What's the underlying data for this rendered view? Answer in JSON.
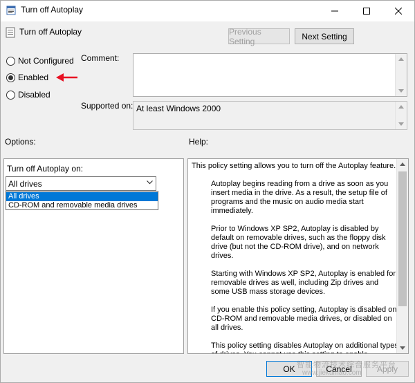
{
  "window": {
    "title": "Turn off Autoplay"
  },
  "header": {
    "title": "Turn off Autoplay"
  },
  "buttons": {
    "previous_label": "Previous Setting",
    "next_label": "Next Setting",
    "ok_label": "OK",
    "cancel_label": "Cancel",
    "apply_label": "Apply"
  },
  "radios": {
    "not_configured": "Not Configured",
    "enabled": "Enabled",
    "disabled": "Disabled",
    "selected": "enabled"
  },
  "comment": {
    "label": "Comment:",
    "value": ""
  },
  "supported_on": {
    "label": "Supported on:",
    "value": "At least Windows 2000"
  },
  "options": {
    "label": "Options:",
    "field_label": "Turn off Autoplay on:",
    "selected_value": "All drives",
    "dropdown_options": [
      "All drives",
      "CD-ROM and removable media drives"
    ]
  },
  "help": {
    "label": "Help:",
    "paragraphs": [
      "This policy setting allows you to turn off the Autoplay feature.",
      "Autoplay begins reading from a drive as soon as you insert media in the drive. As a result, the setup file of programs and the music on audio media start immediately.",
      "Prior to Windows XP SP2, Autoplay is disabled by default on removable drives, such as the floppy disk drive (but not the CD-ROM drive), and on network drives.",
      "Starting with Windows XP SP2, Autoplay is enabled for removable drives as well, including Zip drives and some USB mass storage devices.",
      "If you enable this policy setting, Autoplay is disabled on CD-ROM and removable media drives, or disabled on all drives.",
      "This policy setting disables Autoplay on additional types of drives. You cannot use this setting to enable Autoplay on drives on which it is disabled by default."
    ]
  },
  "watermark": {
    "line1": "智能物流技术综合服务平台",
    "line2": "www.jiekumao.com"
  },
  "colors": {
    "accent": "#0078d7",
    "annotation_arrow": "#e81123"
  },
  "icons": {
    "title": "policy-setting-icon",
    "annotation": "red-arrow-icon"
  }
}
